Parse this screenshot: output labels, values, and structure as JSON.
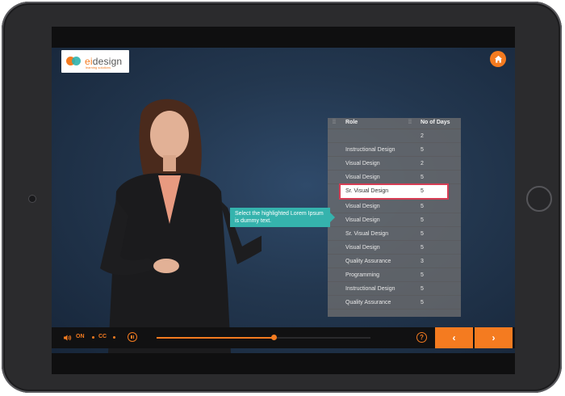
{
  "logo": {
    "text_e": "ei",
    "text_rest": "design",
    "tagline": "learning solutions"
  },
  "callout": {
    "text": "Select the highlighted Lorem Ipsum is dummy text."
  },
  "table": {
    "headers": {
      "role": "Role",
      "days": "No of Days"
    },
    "rows": [
      {
        "role": "",
        "days": "2"
      },
      {
        "role": "Instructional Design",
        "days": "5"
      },
      {
        "role": "Visual Design",
        "days": "2"
      },
      {
        "role": "Visual Design",
        "days": "5"
      },
      {
        "role": "Sr. Visual Design",
        "days": "5",
        "highlighted": true
      },
      {
        "role": "Visual Design",
        "days": "5"
      },
      {
        "role": "Visual Design",
        "days": "5"
      },
      {
        "role": "Sr. Visual Design",
        "days": "5"
      },
      {
        "role": "Visual Design",
        "days": "5"
      },
      {
        "role": "Quality Assurance",
        "days": "3"
      },
      {
        "role": "Programming",
        "days": "5"
      },
      {
        "role": "Instructional Design",
        "days": "5"
      },
      {
        "role": "Quality Assurance",
        "days": "5"
      }
    ]
  },
  "controls": {
    "audio_label": "ON",
    "cc_label": "CC",
    "progress": 0.55,
    "help_label": "?",
    "prev_label": "‹",
    "next_label": "›"
  },
  "icons": {
    "home": "home-icon",
    "volume": "volume-icon",
    "pause": "pause-icon",
    "help": "help-icon",
    "prev": "chevron-left-icon",
    "next": "chevron-right-icon"
  },
  "colors": {
    "accent": "#f47b20",
    "callout": "#35b3ad",
    "highlight_border": "#d63d54"
  }
}
